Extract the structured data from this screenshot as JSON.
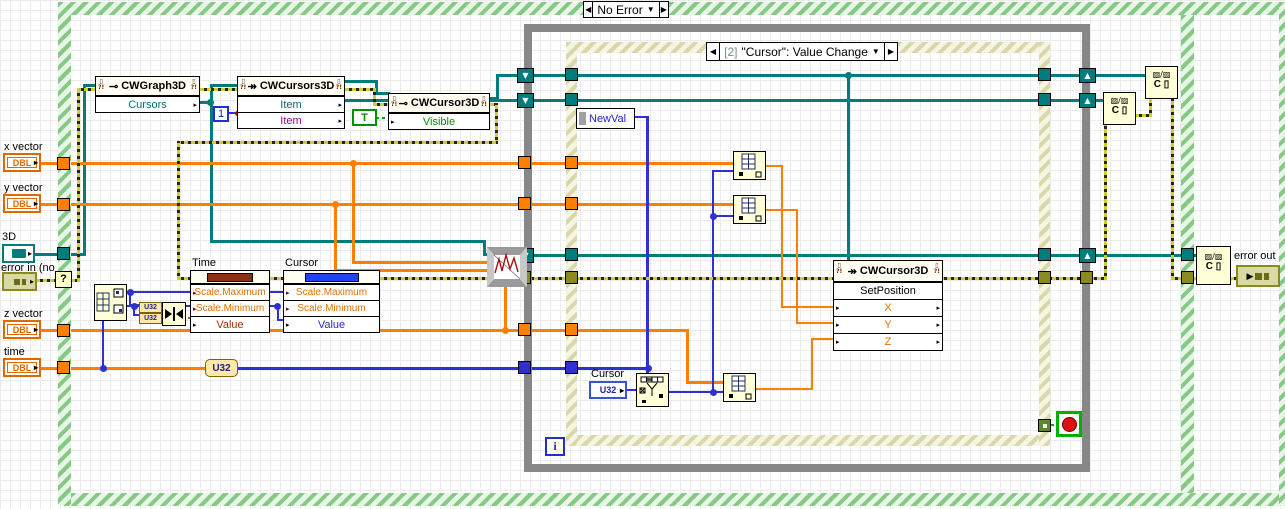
{
  "ui": {
    "arrow_left": "◀",
    "arrow_right": "▶",
    "dropdown": "▼",
    "shift_up": "▲",
    "shift_down": "▼",
    "selector_glyph": "?",
    "page_glyph": "▯",
    "err_glyph": "?!"
  },
  "icons": {
    "property": "⊸",
    "invoke": "↠"
  },
  "case_structure": {
    "selector_label": "No Error"
  },
  "event_structure": {
    "selector_prefix": "[2]",
    "selector_label": "\"Cursor\": Value Change"
  },
  "while_loop": {
    "iteration_label": "i"
  },
  "left_terminals": {
    "x_vector": {
      "label": "x vector",
      "dtype": "DBL"
    },
    "y_vector": {
      "label": "y vector",
      "dtype": "DBL"
    },
    "graph3d": {
      "label": "3D"
    },
    "error_in": {
      "label": "error in (no e"
    },
    "z_vector": {
      "label": "z vector",
      "dtype": "DBL"
    },
    "time": {
      "label": "time",
      "dtype": "DBL"
    }
  },
  "right_terminals": {
    "error_out": {
      "label": "error out"
    }
  },
  "nodes": {
    "cwgraph3d": {
      "title": "CWGraph3D",
      "rows": [
        "Cursors"
      ]
    },
    "cwcursors3d": {
      "title": "CWCursors3D",
      "rows": [
        "Item",
        "Item"
      ]
    },
    "cwcursor3d_visible": {
      "title": "CWCursor3D",
      "rows": [
        "Visible"
      ]
    },
    "time_property": {
      "label": "Time",
      "rows": [
        "Scale.Maximum",
        "Scale.Minimum",
        "Value"
      ]
    },
    "cursor_property": {
      "label": "Cursor",
      "rows": [
        "Scale.Maximum",
        "Scale.Minimum",
        "Value"
      ]
    },
    "setposition": {
      "title": "CWCursor3D",
      "method": "SetPosition",
      "params": [
        "X",
        "Y",
        "Z"
      ]
    },
    "newval": {
      "label": "NewVal"
    },
    "cursor_control": {
      "label": "Cursor",
      "dtype": "U32"
    }
  },
  "constants": {
    "item_index": "1",
    "visible_true": "T",
    "to_u32": "U32",
    "u32_a": "U32",
    "u32_b": "U32"
  }
}
